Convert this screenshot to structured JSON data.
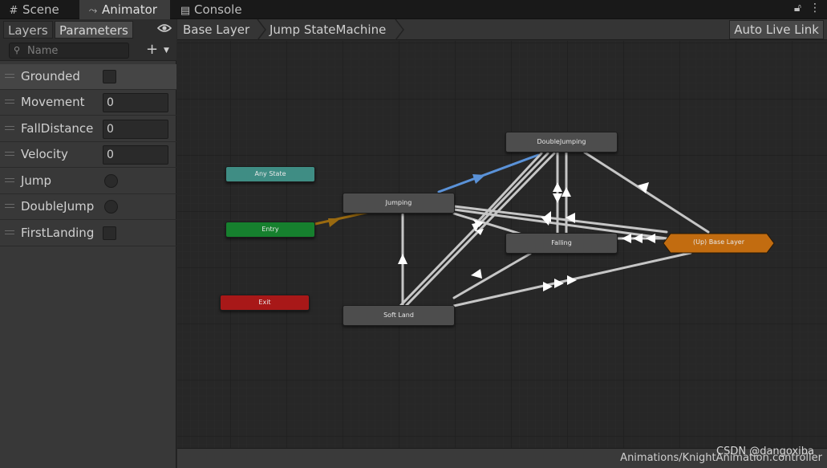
{
  "tabs": [
    {
      "label": "Scene",
      "icon": "grid-icon"
    },
    {
      "label": "Animator",
      "icon": "animator-icon"
    },
    {
      "label": "Console",
      "icon": "console-icon"
    }
  ],
  "left_panel": {
    "tab_layers": "Layers",
    "tab_parameters": "Parameters",
    "search_placeholder": "Name",
    "params": [
      {
        "name": "Grounded",
        "type": "bool"
      },
      {
        "name": "Movement",
        "type": "float",
        "value": "0"
      },
      {
        "name": "FallDistance",
        "type": "float",
        "value": "0"
      },
      {
        "name": "Velocity",
        "type": "float",
        "value": "0"
      },
      {
        "name": "Jump",
        "type": "trigger"
      },
      {
        "name": "DoubleJump",
        "type": "trigger"
      },
      {
        "name": "FirstLanding",
        "type": "bool"
      }
    ]
  },
  "breadcrumb": {
    "items": [
      "Base Layer",
      "Jump StateMachine"
    ],
    "auto_live_link": "Auto Live Link"
  },
  "states": {
    "any_state": "Any State",
    "entry": "Entry",
    "exit": "Exit",
    "jumping": "Jumping",
    "double_jumping": "DoubleJumping",
    "falling": "Falling",
    "soft_land": "Soft Land",
    "up_base_layer": "(Up) Base Layer"
  },
  "colors": {
    "any_state": "#3f8d84",
    "entry": "#16802e",
    "exit": "#a81818",
    "up_base_layer": "#c26c10",
    "default_transition": "#9a6a10",
    "selected_transition": "#5a92d8"
  },
  "status": {
    "path": "Animations/KnightAnimation.controller",
    "watermark": "CSDN @dangoxiba"
  }
}
